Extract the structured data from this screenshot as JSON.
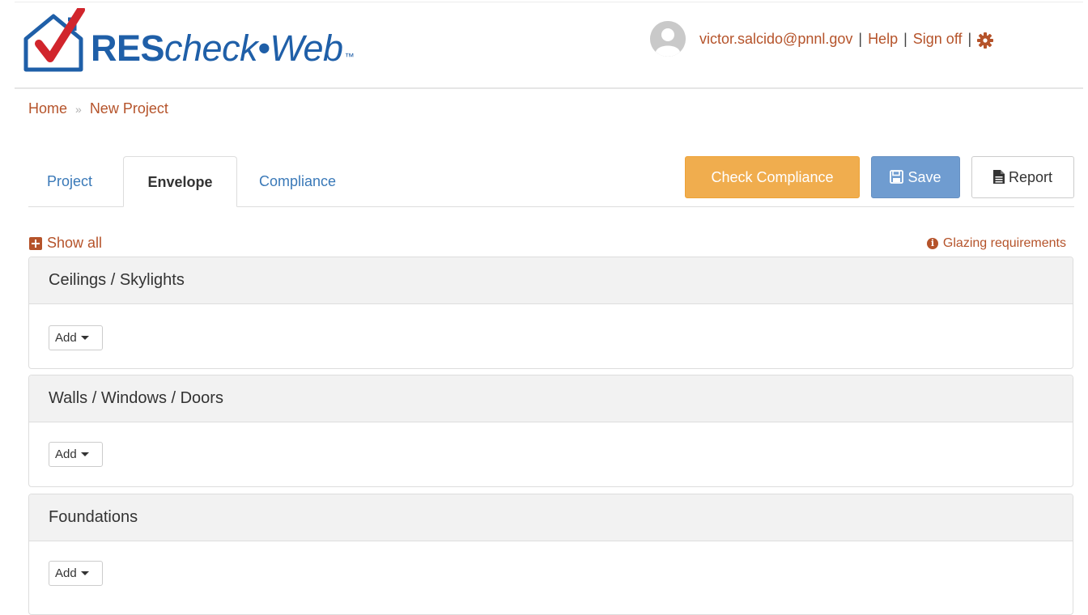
{
  "header": {
    "logo_res": "RES",
    "logo_check": "check•Web",
    "logo_tm": "™",
    "user_email": "victor.salcido@pnnl.gov",
    "help_label": "Help",
    "signoff_label": "Sign off",
    "separator": "|"
  },
  "breadcrumb": {
    "home": "Home",
    "separator": "»",
    "current": "New Project"
  },
  "tabs": [
    {
      "label": "Project",
      "active": false
    },
    {
      "label": "Envelope",
      "active": true
    },
    {
      "label": "Compliance",
      "active": false
    }
  ],
  "actions": {
    "check_compliance": "Check Compliance",
    "save": "Save",
    "report": "Report"
  },
  "toolbar": {
    "show_all": "Show all",
    "glazing": "Glazing requirements"
  },
  "panels": [
    {
      "title": "Ceilings / Skylights",
      "add_label": "Add"
    },
    {
      "title": "Walls / Windows / Doors",
      "add_label": "Add"
    },
    {
      "title": "Foundations",
      "add_label": "Add"
    }
  ],
  "colors": {
    "link": "#b5532a",
    "tab_link": "#3a79b8",
    "warning_button": "#f0ad4e",
    "primary_button": "#6f9cd0",
    "logo_blue": "#1f5fa8",
    "logo_red": "#d1252c"
  }
}
